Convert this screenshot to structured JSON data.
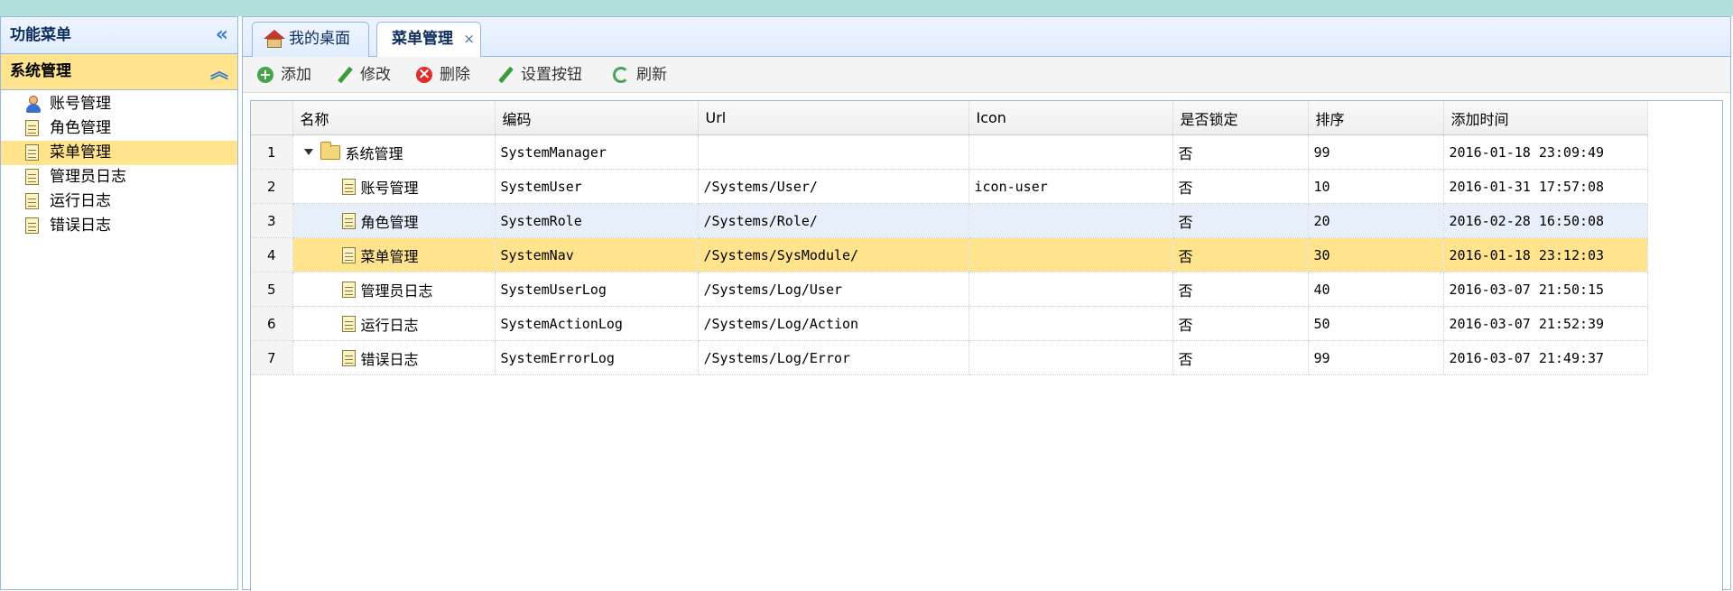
{
  "sidebar": {
    "title": "功能菜单",
    "section": "系统管理",
    "items": [
      {
        "label": "账号管理",
        "icon": "user-icon"
      },
      {
        "label": "角色管理",
        "icon": "doc-icon"
      },
      {
        "label": "菜单管理",
        "icon": "doc-icon",
        "selected": true
      },
      {
        "label": "管理员日志",
        "icon": "doc-icon"
      },
      {
        "label": "运行日志",
        "icon": "doc-icon"
      },
      {
        "label": "错误日志",
        "icon": "doc-icon"
      }
    ]
  },
  "tabs": [
    {
      "label": "我的桌面",
      "icon": "home-icon"
    },
    {
      "label": "菜单管理",
      "active": true,
      "closable": true,
      "close_glyph": "×"
    }
  ],
  "toolbar": {
    "add": "添加",
    "edit": "修改",
    "delete": "删除",
    "set_buttons": "设置按钮",
    "refresh": "刷新"
  },
  "grid": {
    "columns": [
      "名称",
      "编码",
      "Url",
      "Icon",
      "是否锁定",
      "排序",
      "添加时间"
    ],
    "rows": [
      {
        "no": "1",
        "name": "系统管理",
        "code": "SystemManager",
        "url": "",
        "icon": "",
        "locked": "否",
        "sort": "99",
        "time": "2016-01-18 23:09:49"
      },
      {
        "no": "2",
        "name": "账号管理",
        "code": "SystemUser",
        "url": "/Systems/User/",
        "icon": "icon-user",
        "locked": "否",
        "sort": "10",
        "time": "2016-01-31 17:57:08"
      },
      {
        "no": "3",
        "name": "角色管理",
        "code": "SystemRole",
        "url": "/Systems/Role/",
        "icon": "",
        "locked": "否",
        "sort": "20",
        "time": "2016-02-28 16:50:08"
      },
      {
        "no": "4",
        "name": "菜单管理",
        "code": "SystemNav",
        "url": "/Systems/SysModule/",
        "icon": "",
        "locked": "否",
        "sort": "30",
        "time": "2016-01-18 23:12:03"
      },
      {
        "no": "5",
        "name": "管理员日志",
        "code": "SystemUserLog",
        "url": "/Systems/Log/User",
        "icon": "",
        "locked": "否",
        "sort": "40",
        "time": "2016-03-07 21:50:15"
      },
      {
        "no": "6",
        "name": "运行日志",
        "code": "SystemActionLog",
        "url": "/Systems/Log/Action",
        "icon": "",
        "locked": "否",
        "sort": "50",
        "time": "2016-03-07 21:52:39"
      },
      {
        "no": "7",
        "name": "错误日志",
        "code": "SystemErrorLog",
        "url": "/Systems/Log/Error",
        "icon": "",
        "locked": "否",
        "sort": "99",
        "time": "2016-03-07 21:49:37"
      }
    ]
  },
  "colors": {
    "accent": "#95b8e7",
    "selected": "#ffe48d",
    "alt_row": "#e7effb"
  }
}
